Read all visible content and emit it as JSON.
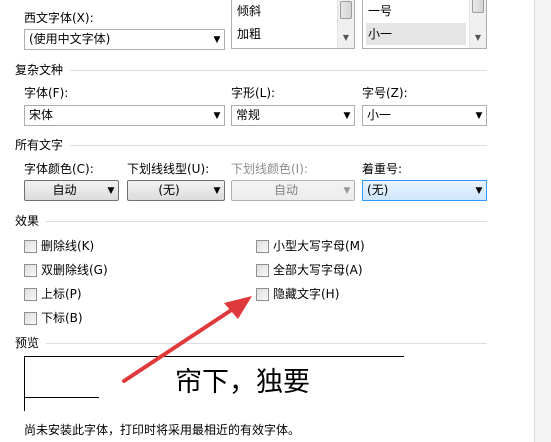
{
  "western": {
    "font_label": "西文字体(X):",
    "font_value": "(使用中文字体)",
    "style_items": [
      "倾斜",
      "加粗"
    ],
    "size_items": [
      "一号",
      "小一"
    ],
    "size_selected": "小一"
  },
  "complex": {
    "section": "复杂文种",
    "font_label": "字体(F):",
    "font_value": "宋体",
    "style_label": "字形(L):",
    "style_value": "常规",
    "size_label": "字号(Z):",
    "size_value": "小一"
  },
  "alltext": {
    "section": "所有文字",
    "color_label": "字体颜色(C):",
    "color_value": "自动",
    "underline_label": "下划线线型(U):",
    "underline_value": "(无)",
    "underline_color_label": "下划线颜色(I):",
    "underline_color_value": "自动",
    "emphasis_label": "着重号:",
    "emphasis_value": "(无)"
  },
  "effects": {
    "section": "效果",
    "left": [
      "删除线(K)",
      "双删除线(G)",
      "上标(P)",
      "下标(B)"
    ],
    "right": [
      "小型大写字母(M)",
      "全部大写字母(A)",
      "隐藏文字(H)"
    ]
  },
  "preview": {
    "section": "预览",
    "sample": "帘下，独要",
    "note": "尚未安装此字体，打印时将采用最相近的有效字体。"
  },
  "colors": {
    "annotation_arrow": "#e0393b",
    "separator": "#d5dfe5",
    "focus_border": "#3399ff"
  }
}
